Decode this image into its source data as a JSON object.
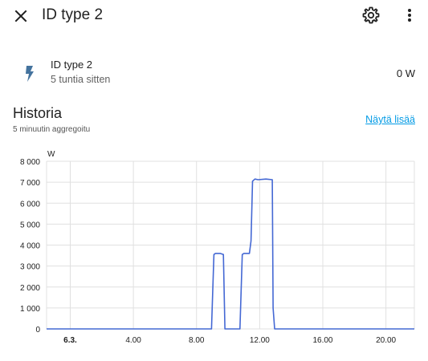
{
  "header": {
    "title": "ID type 2",
    "close_icon": "close-icon",
    "settings_icon": "gear-icon",
    "more_icon": "more-vertical-icon"
  },
  "entity": {
    "icon": "lightning-bolt-icon",
    "name": "ID type 2",
    "last_changed": "5 tuntia sitten",
    "state": "0 W"
  },
  "history": {
    "title": "Historia",
    "subtitle": "5 minuutin aggregoitu",
    "show_more": "Näytä lisää"
  },
  "colors": {
    "line": "#4468d4",
    "link": "#039be5",
    "grid": "#e0e0e0"
  },
  "chart_data": {
    "type": "line",
    "ylabel": "W",
    "ylim": [
      0,
      8000
    ],
    "y_ticks": [
      {
        "value": 0,
        "label": "0"
      },
      {
        "value": 1000,
        "label": "1 000"
      },
      {
        "value": 2000,
        "label": "2 000"
      },
      {
        "value": 3000,
        "label": "3 000"
      },
      {
        "value": 4000,
        "label": "4 000"
      },
      {
        "value": 5000,
        "label": "5 000"
      },
      {
        "value": 6000,
        "label": "6 000"
      },
      {
        "value": 7000,
        "label": "7 000"
      },
      {
        "value": 8000,
        "label": "8 000"
      }
    ],
    "xlim": [
      -1.5,
      21.8
    ],
    "x_ticks": [
      {
        "value": 0,
        "label": "6.3.",
        "bold": true
      },
      {
        "value": 4,
        "label": "4.00",
        "bold": false
      },
      {
        "value": 8,
        "label": "8.00",
        "bold": false
      },
      {
        "value": 12,
        "label": "12.00",
        "bold": false
      },
      {
        "value": 16,
        "label": "16.00",
        "bold": false
      },
      {
        "value": 20,
        "label": "20.00",
        "bold": false
      }
    ],
    "series": [
      {
        "x": [
          -1.5,
          8.95,
          9.1,
          9.2,
          9.5,
          9.7,
          9.8,
          9.95,
          10.75,
          10.9,
          11.0,
          11.35,
          11.45,
          11.55,
          11.7,
          11.9,
          12.4,
          12.8,
          12.85,
          12.95,
          21.8
        ],
        "y": [
          0,
          0,
          3550,
          3600,
          3600,
          3550,
          0,
          0,
          0,
          3550,
          3600,
          3600,
          4200,
          7050,
          7150,
          7120,
          7150,
          7120,
          1000,
          0,
          0
        ]
      }
    ]
  }
}
